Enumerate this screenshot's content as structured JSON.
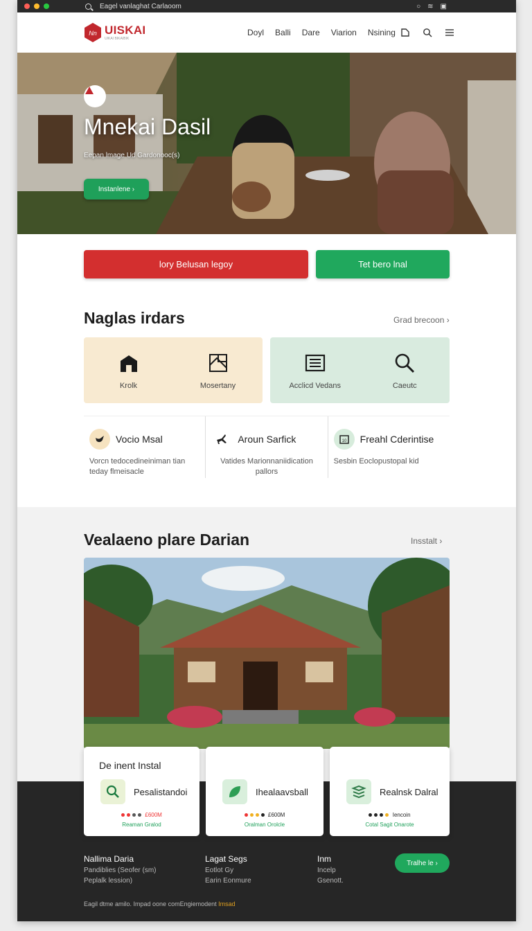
{
  "os_bar": {
    "title": "Eagel vanlaghat Carlaoom",
    "colors": [
      "#ff5f57",
      "#febc2e",
      "#28c840"
    ]
  },
  "header": {
    "brand": "UISKAI",
    "brand_sub": "UIKAI BIKAIBIK",
    "nav": [
      "Doyl",
      "Balli",
      "Dare",
      "Viarion",
      "Nsining"
    ]
  },
  "hero": {
    "title": "Mnekai Dasil",
    "subtitle": "Eepan lmage Ud Gardonooc(s)",
    "button": "Instanlene ›"
  },
  "cta": {
    "primary": "lory Belusan legoy",
    "secondary": "Tet bero lnal"
  },
  "section1": {
    "title": "Naglas irdars",
    "link": "Grad brecoon",
    "cards_left": [
      {
        "icon": "house-icon",
        "label": "Krolk"
      },
      {
        "icon": "grid-map-icon",
        "label": "Mosertany"
      }
    ],
    "cards_right": [
      {
        "icon": "archive-icon",
        "label": "Acclicd Vedans"
      },
      {
        "icon": "search-icon",
        "label": "Caeutc"
      }
    ],
    "features": [
      {
        "icon": "bird-icon",
        "title": "Vocio Msal",
        "desc": "Vorcn tedocedineiniman tian teday flmeisacle",
        "icon_bg": "#f6e3c0"
      },
      {
        "icon": "plane-icon",
        "title": "Aroun Sarfick",
        "desc": "Vatides Marionnaniidication pallors",
        "icon_bg": "#ffffff"
      },
      {
        "icon": "calendar-icon",
        "title": "Freahl Cderintise",
        "desc": "Sesbin Eoclopustopal kid",
        "icon_bg": "#d7ecdc"
      }
    ]
  },
  "section2": {
    "title": "Vealaeno plare Darian",
    "link": "Insstalt",
    "cards": [
      {
        "title": "De inent Instal",
        "name": "Pesalistandoi",
        "meta": "£600M",
        "sub": "Reaman Gralod",
        "icon": "magnifier-icon",
        "icon_bg": "#eaf2d6",
        "dots": [
          "#e33",
          "#e33",
          "#555",
          "#555"
        ]
      },
      {
        "title": "",
        "name": "Ihealaavsball",
        "meta": "£600M",
        "sub": "Oralman Orolcle",
        "icon": "leaf-icon",
        "icon_bg": "#d9efdc",
        "dots": [
          "#e33",
          "#f0b020",
          "#f0b020",
          "#222"
        ]
      },
      {
        "title": "",
        "name": "Realnsk Dalral",
        "meta": "Iencoin",
        "sub": "Cotal Sagit Onarote",
        "icon": "layers-icon",
        "icon_bg": "#d9efdc",
        "dots": [
          "#222",
          "#222",
          "#222",
          "#f0b020"
        ]
      }
    ]
  },
  "footer": {
    "cols": [
      {
        "title": "Nallima Daria",
        "lines": [
          "Pandiblies (Seofer (sm)",
          "Peplalk lession)"
        ]
      },
      {
        "title": "Lagat Segs",
        "lines": [
          "Eotlot Gy",
          "Earin Eonmure"
        ]
      },
      {
        "title": "Inm",
        "lines": [
          "Incelp",
          "Gsenott."
        ]
      }
    ],
    "button": "Tralhe le ›",
    "copyright": "Eagil dtme amilo. Impad oone comEngiemodent",
    "copyright_link": "Imsad"
  }
}
